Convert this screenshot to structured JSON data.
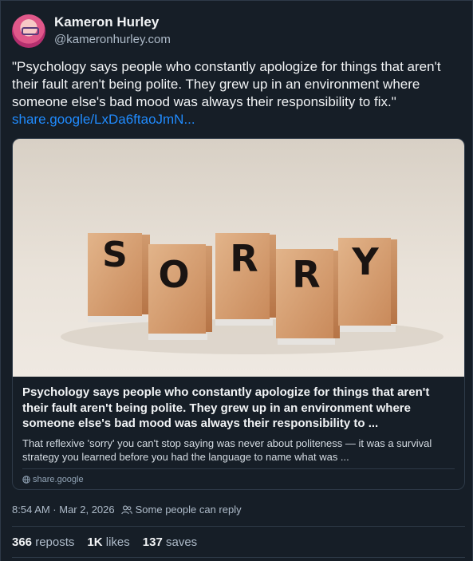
{
  "author": {
    "display_name": "Kameron Hurley",
    "handle": "@kameronhurley.com",
    "avatar_icon": "avatar-image"
  },
  "post": {
    "text": "\"Psychology says people who constantly apologize for things that aren't their fault aren't being polite. They grew up in an environment where someone else's bad mood was always their responsibility to fix.\"",
    "link_text": "share.google/LxDa6ftaoJmN..."
  },
  "embed": {
    "image_letters": [
      "S",
      "O",
      "R",
      "R",
      "Y"
    ],
    "title": "Psychology says people who constantly apologize for things that aren't their fault aren't being polite. They grew up in an environment where someone else's bad mood was always their responsibility to ...",
    "description": "That reflexive 'sorry' you can't stop saying was never about politeness — it was a survival strategy you learned before you had the language to name what was ...",
    "domain": "share.google"
  },
  "meta": {
    "timestamp": "8:54 AM · Mar 2, 2026",
    "reply_setting": "Some people can reply"
  },
  "stats": {
    "reposts_count": "366",
    "reposts_label": "reposts",
    "likes_count": "1K",
    "likes_label": "likes",
    "saves_count": "137",
    "saves_label": "saves"
  },
  "colors": {
    "background": "#161e27",
    "link": "#208bfe",
    "text": "#f1f3f5",
    "muted": "#aebbc9",
    "border": "#2e3a48"
  }
}
